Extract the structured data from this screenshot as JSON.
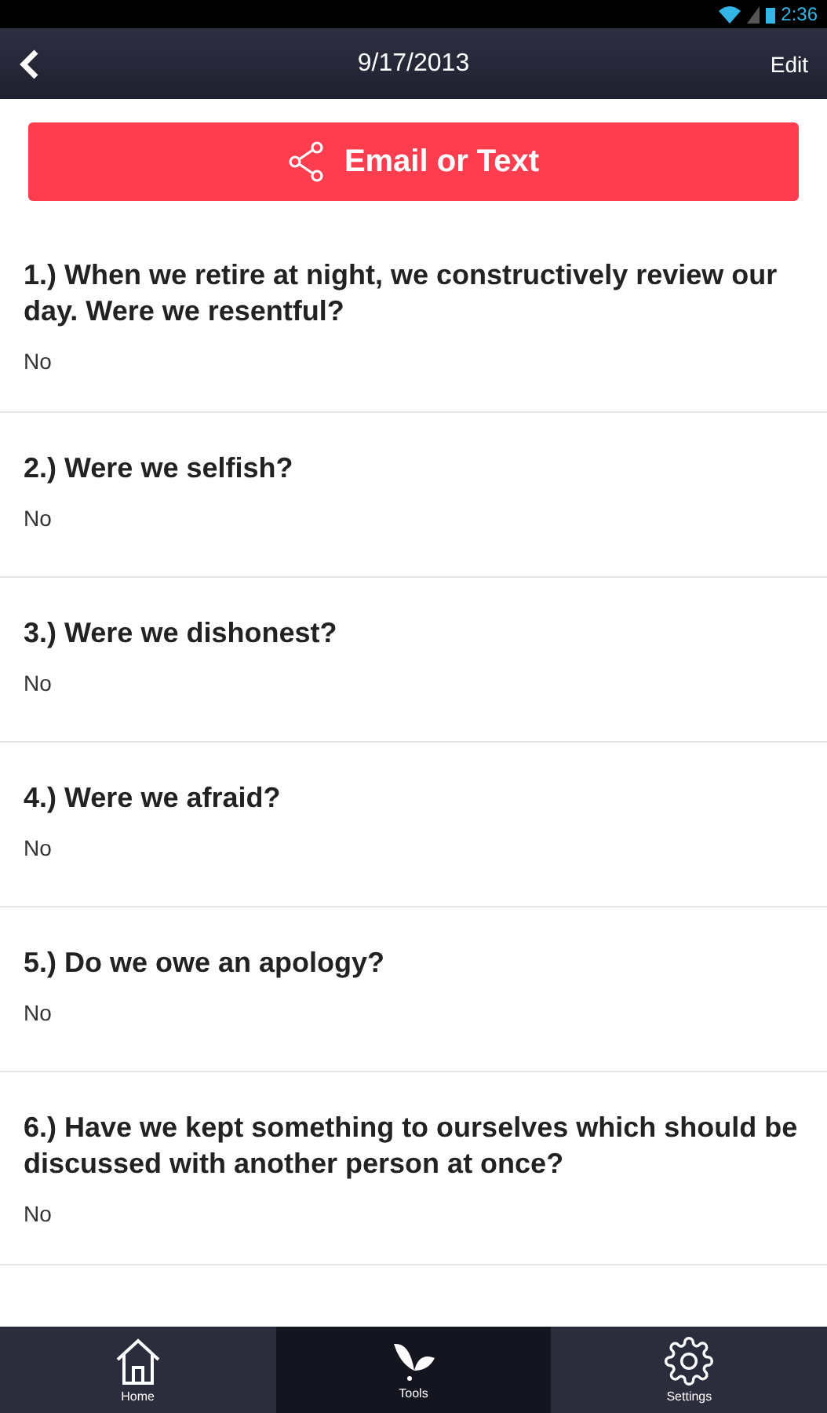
{
  "status_bar": {
    "time": "2:36"
  },
  "header": {
    "title": "9/17/2013",
    "action": "Edit"
  },
  "share_button": {
    "label": "Email or Text"
  },
  "questions": [
    {
      "question": "1.) When we retire at night, we constructively review our day. Were we resentful?",
      "answer": "No"
    },
    {
      "question": "2.) Were we selfish?",
      "answer": "No"
    },
    {
      "question": "3.) Were we dishonest?",
      "answer": "No"
    },
    {
      "question": "4.) Were we afraid?",
      "answer": "No"
    },
    {
      "question": "5.) Do we owe an apology?",
      "answer": "No"
    },
    {
      "question": "6.) Have we kept something to ourselves which should be discussed with another person at once?",
      "answer": "No"
    }
  ],
  "tabs": [
    {
      "label": "Home",
      "kind": "home",
      "selected": false
    },
    {
      "label": "Tools",
      "kind": "tools",
      "selected": true
    },
    {
      "label": "Settings",
      "kind": "settings",
      "selected": false
    }
  ]
}
